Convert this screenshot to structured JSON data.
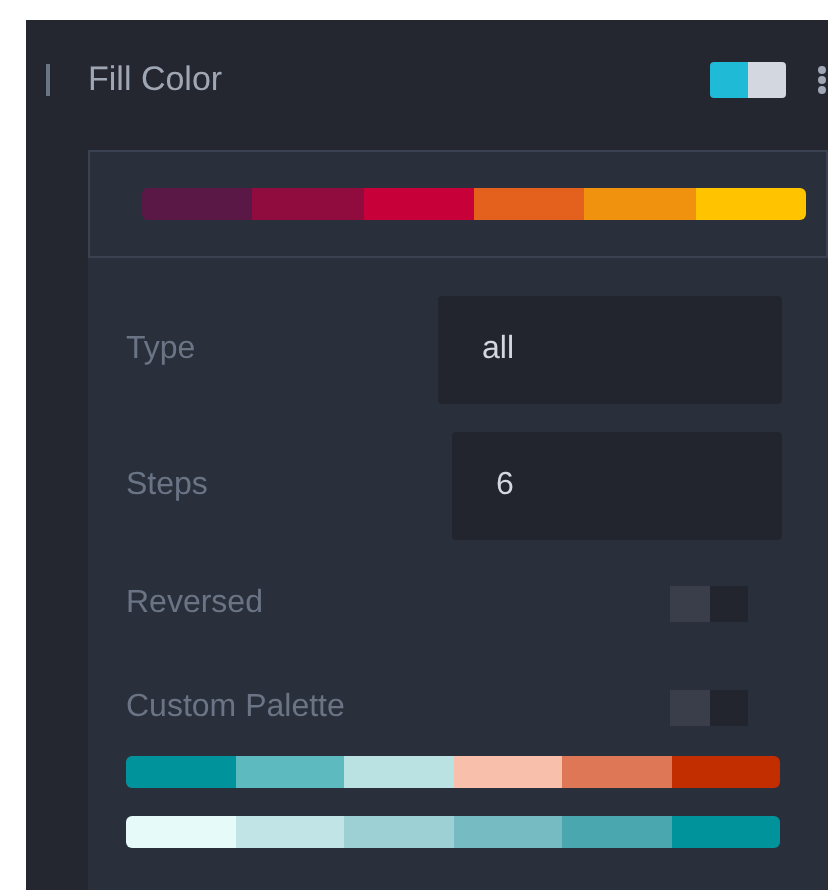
{
  "header": {
    "title": "Fill Color",
    "enabled": true
  },
  "selected_palette": {
    "colors": [
      {
        "color": "#5a1846"
      },
      {
        "color": "#900c3f"
      },
      {
        "color": "#c70039"
      },
      {
        "color": "#e3611c"
      },
      {
        "color": "#f1920e"
      },
      {
        "color": "#ffc300"
      }
    ]
  },
  "fields": [
    {
      "label": "Type",
      "value": "all"
    },
    {
      "label": "Steps",
      "value": "6"
    }
  ],
  "switches": [
    {
      "label": "Reversed",
      "on": false
    },
    {
      "label": "Custom Palette",
      "on": false
    }
  ],
  "palettes": [
    {
      "colors": [
        {
          "color": "#00939c"
        },
        {
          "color": "#5dbabf"
        },
        {
          "color": "#bae2e2"
        },
        {
          "color": "#f8c0aa"
        },
        {
          "color": "#dd7755"
        },
        {
          "color": "#c22e00"
        }
      ]
    },
    {
      "colors": [
        {
          "color": "#e6fafa"
        },
        {
          "color": "#c1e5e6"
        },
        {
          "color": "#9dd0d4"
        },
        {
          "color": "#75bbc1"
        },
        {
          "color": "#4ba7af"
        },
        {
          "color": "#00939c"
        }
      ]
    }
  ]
}
